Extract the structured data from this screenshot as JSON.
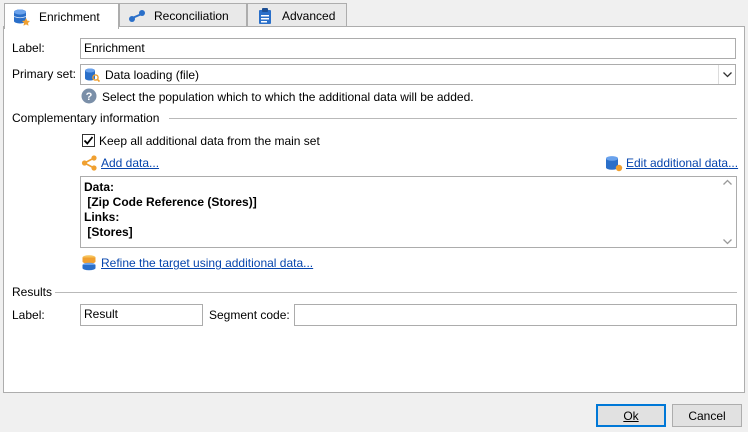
{
  "tabs": [
    {
      "label": "Enrichment",
      "icon": "database-star-icon",
      "active": true
    },
    {
      "label": "Reconciliation",
      "icon": "link-nodes-icon",
      "active": false
    },
    {
      "label": "Advanced",
      "icon": "clipboard-icon",
      "active": false
    }
  ],
  "form": {
    "label_caption": "Label:",
    "label_value": "Enrichment",
    "primary_set_caption": "Primary set:",
    "primary_set_value": "Data loading (file)",
    "primary_set_hint": "Select the population which to which the additional data will be added."
  },
  "complementary": {
    "section_title": "Complementary information",
    "keep_all_label": "Keep all additional data from the main set",
    "keep_all_checked": true,
    "add_data_link": "Add data...",
    "edit_additional_link": "Edit additional data...",
    "summary_lines": [
      "Data:",
      " [Zip Code Reference (Stores)]",
      "Links:",
      " [Stores]"
    ],
    "refine_link": "Refine the target using additional data..."
  },
  "results": {
    "section_title": "Results",
    "label_caption": "Label:",
    "label_value": "Result",
    "segment_code_caption": "Segment code:",
    "segment_code_value": ""
  },
  "footer": {
    "ok_label": "Ok",
    "cancel_label": "Cancel"
  },
  "colors": {
    "link": "#0645ad",
    "accent_orange": "#f0a030",
    "db_blue": "#2a6fc9",
    "default_button_border": "#0078d7"
  }
}
